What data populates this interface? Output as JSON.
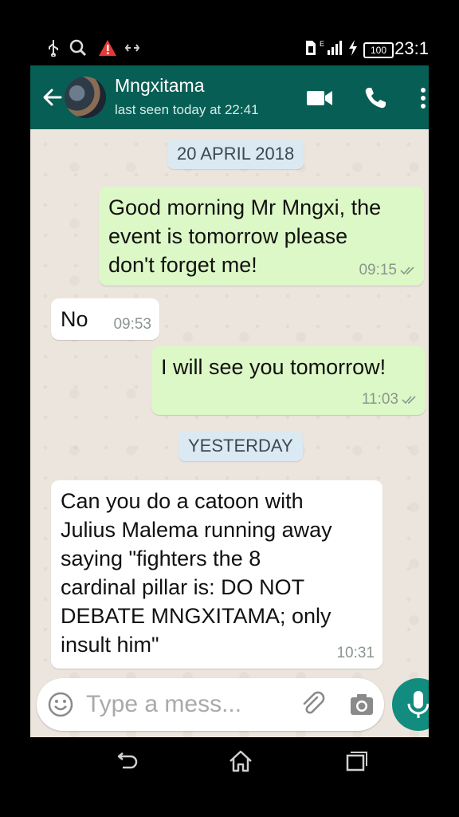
{
  "status_bar": {
    "time": "23:1",
    "battery": "100",
    "icons": [
      "usb-icon",
      "search-icon",
      "warning-icon",
      "link-icon",
      "sim-icon",
      "signal-icon",
      "charging-icon",
      "battery-icon"
    ]
  },
  "header": {
    "contact_name": "Mngxitama",
    "last_seen": "last seen today at 22:41",
    "icons": [
      "back-arrow-icon",
      "avatar",
      "video-call-icon",
      "phone-call-icon",
      "more-vert-icon"
    ],
    "color": "#075e54"
  },
  "chat": {
    "date_chips": [
      "20 APRIL 2018",
      "YESTERDAY"
    ],
    "messages": [
      {
        "direction": "outgoing",
        "text": "Good morning Mr Mngxi, the\nevent is tomorrow please\ndon't forget me!",
        "time": "09:15",
        "status": "read"
      },
      {
        "direction": "incoming",
        "text": "No",
        "time": "09:53"
      },
      {
        "direction": "outgoing",
        "text": "I will see you tomorrow!",
        "time": "11:03",
        "status": "read"
      },
      {
        "direction": "incoming",
        "text": "Can you do a catoon with\nJulius Malema running away\nsaying \"fighters the 8\ncardinal pillar is: DO NOT\nDEBATE MNGXITAMA; only\ninsult him\"",
        "time": "10:31"
      }
    ],
    "outgoing_color": "#dcf8c6",
    "incoming_color": "#ffffff",
    "background_color": "#ece5dd"
  },
  "input_bar": {
    "placeholder": "Type a mess...",
    "icons": [
      "emoji-icon",
      "attach-icon",
      "camera-icon",
      "mic-icon"
    ],
    "mic_color": "#128c7e"
  },
  "nav_bar": {
    "icons": [
      "back-nav-icon",
      "home-nav-icon",
      "recents-nav-icon"
    ]
  }
}
